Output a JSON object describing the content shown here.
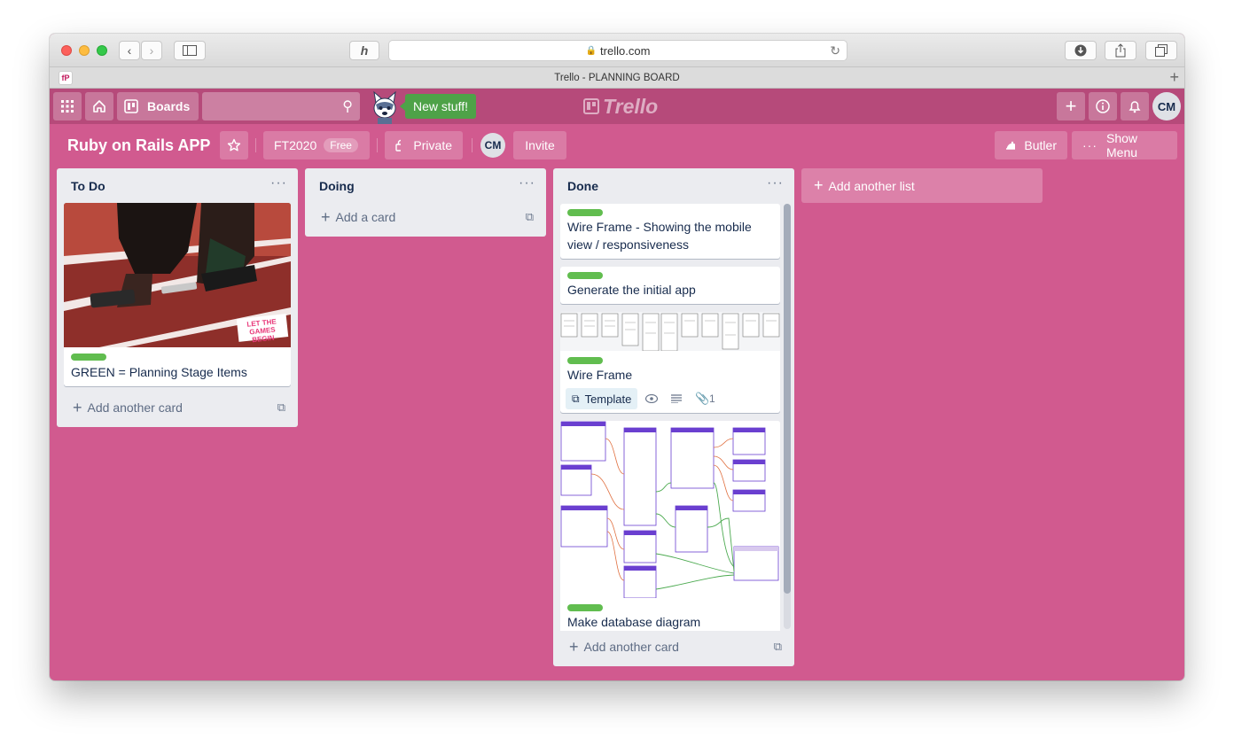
{
  "browser": {
    "url": "trello.com",
    "tab_title": "Trello - PLANNING BOARD",
    "favicon_text": "fP"
  },
  "header": {
    "boards_label": "Boards",
    "new_stuff": "New stuff!",
    "logo_text": "Trello",
    "avatar_initials": "CM"
  },
  "board": {
    "title": "Ruby on Rails APP",
    "team_name": "FT2020",
    "team_badge": "Free",
    "visibility": "Private",
    "member_initials": "CM",
    "invite_label": "Invite",
    "butler_label": "Butler",
    "show_menu_label": "Show Menu"
  },
  "lists": [
    {
      "title": "To Do",
      "add_card": "Add another card",
      "cards": [
        {
          "text": "GREEN = Planning Stage Items",
          "cover_badge": "LET THE GAMES BEGIN"
        }
      ]
    },
    {
      "title": "Doing",
      "add_card": "Add a card",
      "cards": []
    },
    {
      "title": "Done",
      "add_card": "Add another card",
      "cards": [
        {
          "text": "Wire Frame - Showing the mobile view / responsiveness"
        },
        {
          "text": "Generate the initial app"
        },
        {
          "text": "Wire Frame",
          "badge": "Template",
          "attachments": "1"
        },
        {
          "text": "Make database diagram"
        }
      ]
    }
  ],
  "add_list": "Add another list",
  "colors": {
    "board_bg": "#d15a8f",
    "header_bg": "#b64a7a",
    "label_green": "#61bd4f",
    "list_bg": "#ebecf0"
  }
}
